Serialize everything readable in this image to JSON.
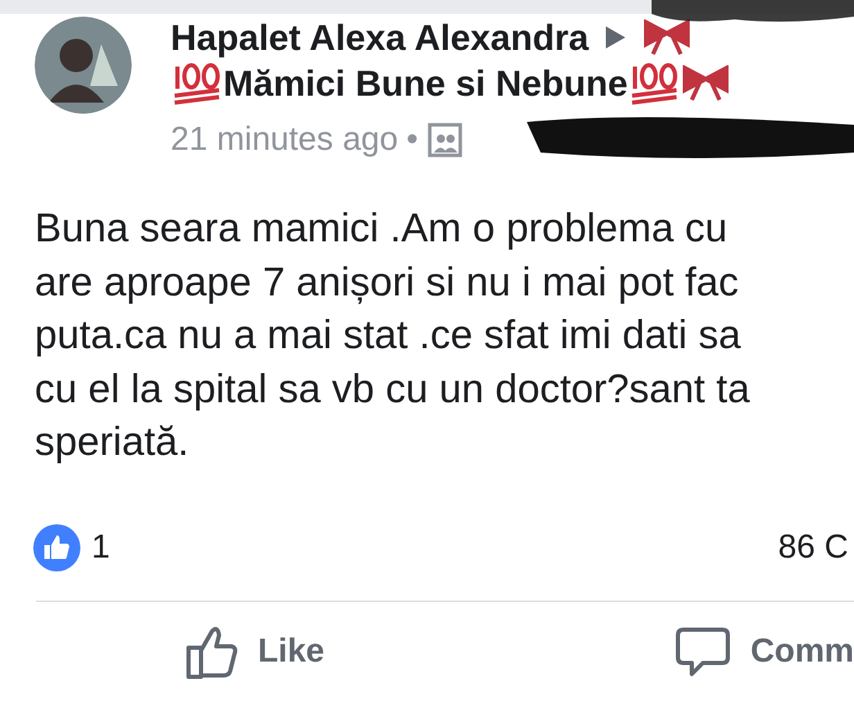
{
  "post": {
    "author": "Hapalet Alexa Alexandra",
    "group": "Mămici Bune si Nebune",
    "time": "21 minutes ago",
    "separator": "•",
    "body_lines": [
      "Buna seara mamici .Am o problema cu",
      "are aproape 7 anișori si nu i mai pot fac",
      "puta.ca nu a mai stat .ce sfat imi dati sa",
      "cu el la spital sa vb cu un doctor?sant ta",
      "speriată."
    ],
    "reactions": {
      "count": "1",
      "comments": "86 C"
    },
    "actions": [
      {
        "kind": "like",
        "label": "Like"
      },
      {
        "kind": "comment",
        "label": "Comm"
      }
    ]
  }
}
